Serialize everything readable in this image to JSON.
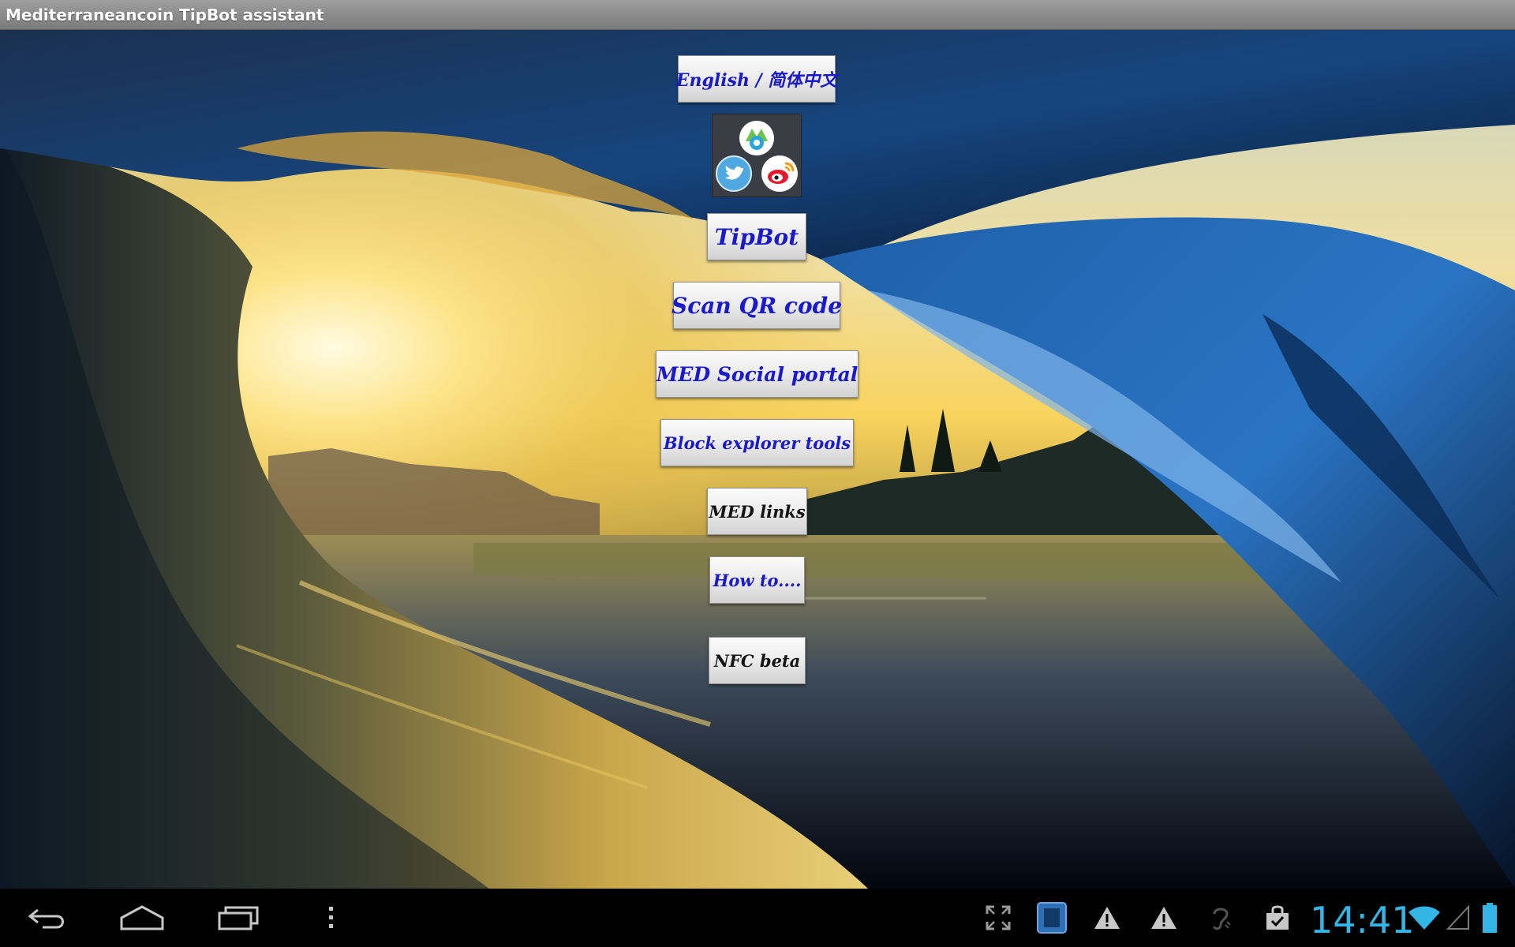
{
  "window": {
    "title": "Mediterraneancoin TipBot assistant"
  },
  "menu": {
    "language_label": "English / 简体中文",
    "tipbot_label": "TipBot",
    "scan_qr_label": "Scan QR code",
    "social_portal_label": "MED Social portal",
    "block_explorer_label": "Block explorer tools",
    "med_links_label": "MED links",
    "how_to_label": "How to....",
    "nfc_label": "NFC beta"
  },
  "social_icons": [
    "mediterraneancoin-icon",
    "twitter-icon",
    "weibo-icon"
  ],
  "status_bar": {
    "time": "14:41",
    "icons": [
      "fullscreen-icon",
      "app-notification-icon",
      "warning-icon",
      "warning-icon",
      "hearing-icon",
      "shopping-bag-icon",
      "wifi-icon",
      "signal-icon",
      "battery-icon"
    ]
  },
  "colors": {
    "button_text_blue": "#1a1acc",
    "button_text_dark": "#141414",
    "clock": "#33b5e5",
    "title_bar": "#8a8a8a"
  }
}
